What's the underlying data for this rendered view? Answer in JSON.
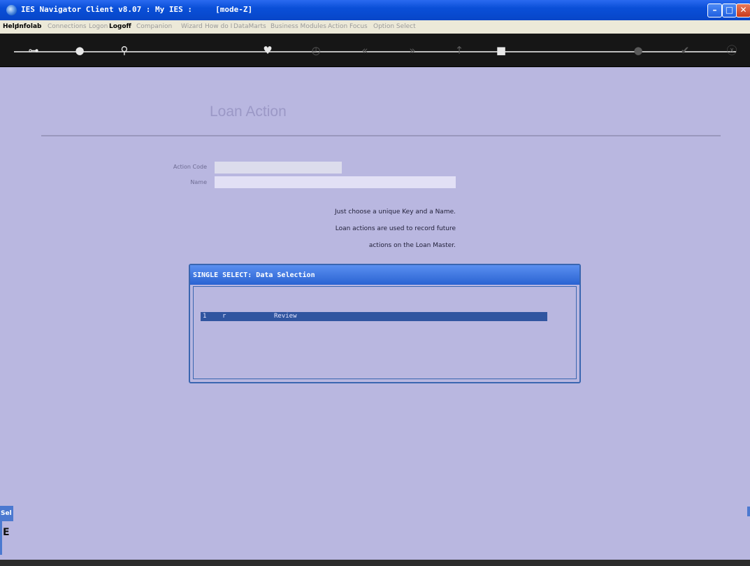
{
  "window": {
    "title": "IES Navigator Client v8.07 : My IES :     [mode-Z]",
    "controls": [
      "minimize-icon",
      "maximize-icon",
      "close-icon"
    ]
  },
  "menu": {
    "items": [
      {
        "label": "Help",
        "enabled": true
      },
      {
        "label": "Infolab",
        "enabled": true
      },
      {
        "label": "Connections",
        "enabled": false
      },
      {
        "label": "Logon",
        "enabled": false
      },
      {
        "label": "Logoff",
        "enabled": true
      },
      {
        "label": "Companion",
        "enabled": false
      },
      {
        "label": "Wizard",
        "enabled": false
      },
      {
        "label": "How do I",
        "enabled": false
      },
      {
        "label": "DataMarts",
        "enabled": false
      },
      {
        "label": "Business Modules",
        "enabled": false
      },
      {
        "label": "Action Focus",
        "enabled": false
      },
      {
        "label": "Option Select",
        "enabled": false
      }
    ]
  },
  "toolbar": {
    "icons": [
      "key-icon",
      "help-icon",
      "search-icon",
      "heart-icon",
      "clock-icon",
      "rewind-icon",
      "fast-forward-icon",
      "up-icon",
      "stop-icon",
      "print-icon",
      "check-icon",
      "close-icon"
    ]
  },
  "form": {
    "heading": "Loan Action",
    "action_code_label": "Action Code",
    "name_label": "Name",
    "action_code_value": "",
    "name_value": "",
    "help_lines": [
      "Just choose a unique Key and a Name.",
      "Loan actions are used to record future",
      "actions on the Loan Master."
    ],
    "colors": {
      "background": "#b9b7e0",
      "code_field": "#dcdcec",
      "name_field": "#e2e0f5",
      "accent": "#3055a0"
    }
  },
  "dialog": {
    "title": "SINGLE SELECT: Data Selection",
    "rows": [
      {
        "num": "1",
        "code": "r",
        "desc": "Review",
        "selected": true
      }
    ]
  },
  "side_widget": {
    "tab_label": "Sel",
    "char": "E"
  }
}
